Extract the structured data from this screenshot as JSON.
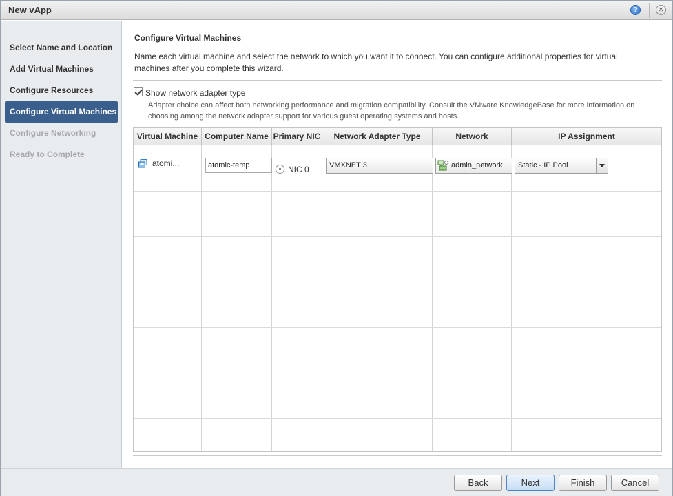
{
  "window": {
    "title": "New vApp",
    "help_icon": "?",
    "close_icon": "✕"
  },
  "steps": [
    {
      "label": "Select Name and Location",
      "state": "completed"
    },
    {
      "label": "Add Virtual Machines",
      "state": "completed"
    },
    {
      "label": "Configure Resources",
      "state": "completed"
    },
    {
      "label": "Configure Virtual Machines",
      "state": "active"
    },
    {
      "label": "Configure Networking",
      "state": "disabled"
    },
    {
      "label": "Ready to Complete",
      "state": "disabled"
    }
  ],
  "page": {
    "title": "Configure Virtual Machines",
    "description": "Name each virtual machine and select the network to which you want it to connect. You can configure additional properties for virtual machines after you complete this wizard.",
    "show_adapter_checkbox_label": "Show network adapter type",
    "show_adapter_checked": true,
    "adapter_note": "Adapter choice can affect both networking performance and migration compatibility. Consult the VMware KnowledgeBase for more information on choosing among the network adapter support for various guest operating systems and hosts."
  },
  "table": {
    "columns": [
      "Virtual Machine",
      "Computer Name",
      "Primary NIC",
      "Network Adapter Type",
      "Network",
      "IP Assignment"
    ],
    "rows": [
      {
        "vm": "atomi...",
        "computer_name": "atomic-temp",
        "primary_nic": "NIC 0",
        "adapter_type": "VMXNET 3",
        "network": "admin_network",
        "ip_assignment": "Static - IP Pool"
      }
    ]
  },
  "footer": {
    "back": "Back",
    "next": "Next",
    "finish": "Finish",
    "cancel": "Cancel"
  },
  "colors": {
    "active_step_bg": "#3a5f8c",
    "sidebar_bg": "#e9ecef",
    "primary_button": "#c6dcf5"
  }
}
